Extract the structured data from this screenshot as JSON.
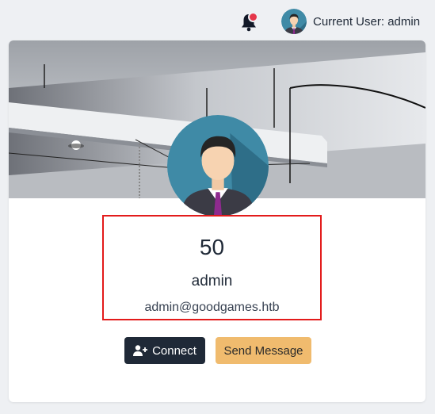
{
  "header": {
    "notification_icon": "bell-icon",
    "has_unread_notification": true,
    "current_user_label": "Current User: admin"
  },
  "profile": {
    "cover_image": "office-ceiling-photo",
    "avatar_icon": "user-avatar",
    "score": "50",
    "username": "admin",
    "email": "admin@goodgames.htb"
  },
  "actions": {
    "connect_label": "Connect",
    "connect_icon": "user-plus-icon",
    "send_message_label": "Send Message"
  },
  "colors": {
    "highlight_border": "#e31b1b",
    "connect_button": "#1f2937",
    "send_message_button": "#f0bb6e",
    "notification_dot": "#e5364a"
  }
}
